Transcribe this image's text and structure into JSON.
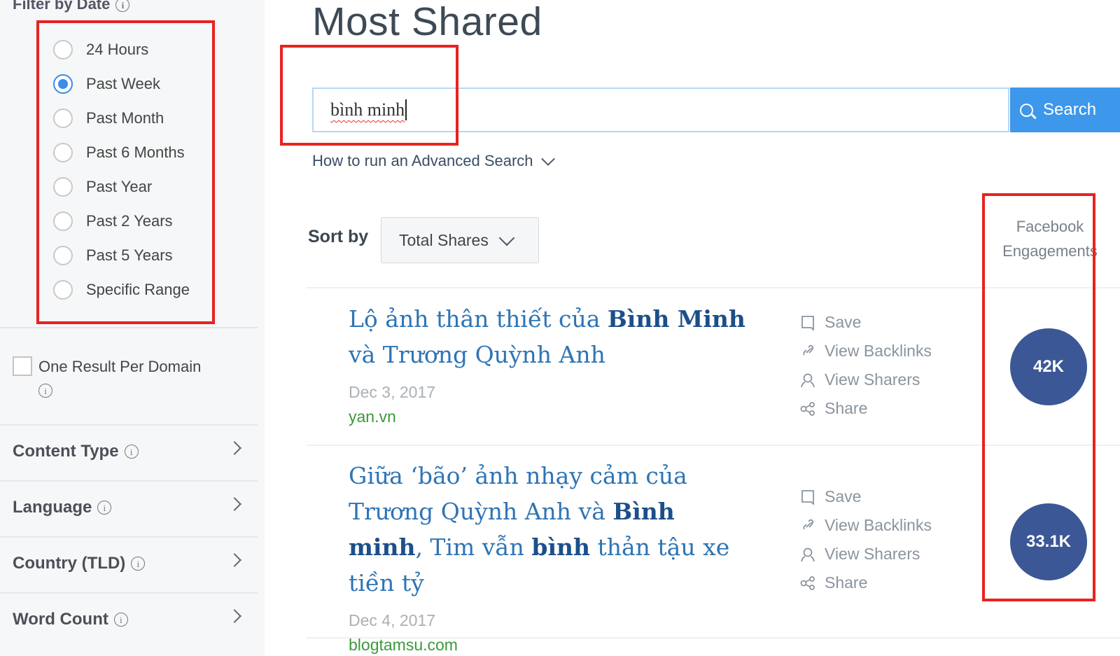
{
  "sidebar": {
    "filter_title": "Filter by Date",
    "date_options": [
      {
        "label": "24 Hours",
        "checked": false
      },
      {
        "label": "Past Week",
        "checked": true
      },
      {
        "label": "Past Month",
        "checked": false
      },
      {
        "label": "Past 6 Months",
        "checked": false
      },
      {
        "label": "Past Year",
        "checked": false
      },
      {
        "label": "Past 2 Years",
        "checked": false
      },
      {
        "label": "Past 5 Years",
        "checked": false
      },
      {
        "label": "Specific Range",
        "checked": false
      }
    ],
    "one_result_label": "One Result Per Domain",
    "sections": [
      {
        "label": "Content Type"
      },
      {
        "label": "Language"
      },
      {
        "label": "Country (TLD)"
      },
      {
        "label": "Word Count"
      }
    ],
    "info_glyph": "i"
  },
  "main": {
    "title": "Most Shared",
    "search": {
      "value": "bình minh",
      "button_label": "Search"
    },
    "advanced_link": "How to run an Advanced Search",
    "sort": {
      "label": "Sort by",
      "value": "Total Shares"
    },
    "fb_column_header": "Facebook Engagements",
    "results": [
      {
        "title_parts": [
          "Lộ ảnh thân thiết của ",
          "Bình Minh",
          " và Trương Quỳnh Anh"
        ],
        "date": "Dec 3, 2017",
        "domain": "yan.vn",
        "facebook_engagements": "42K"
      },
      {
        "title_parts": [
          "Giữa ‘bão’ ảnh nhạy cảm của Trương Quỳnh Anh và ",
          "Bình minh",
          ", Tim vẫn ",
          "bình",
          " thản tậu xe tiền tỷ"
        ],
        "date": "Dec 4, 2017",
        "domain": "blogtamsu.com",
        "facebook_engagements": "33.1K"
      }
    ],
    "actions": {
      "save": "Save",
      "backlinks": "View Backlinks",
      "sharers": "View Sharers",
      "share": "Share"
    }
  },
  "colors": {
    "accent": "#3d97ea",
    "link": "#2e74b5",
    "domain": "#3b9a3b",
    "bubble": "#3b5796",
    "highlight_box": "#e8231f"
  }
}
